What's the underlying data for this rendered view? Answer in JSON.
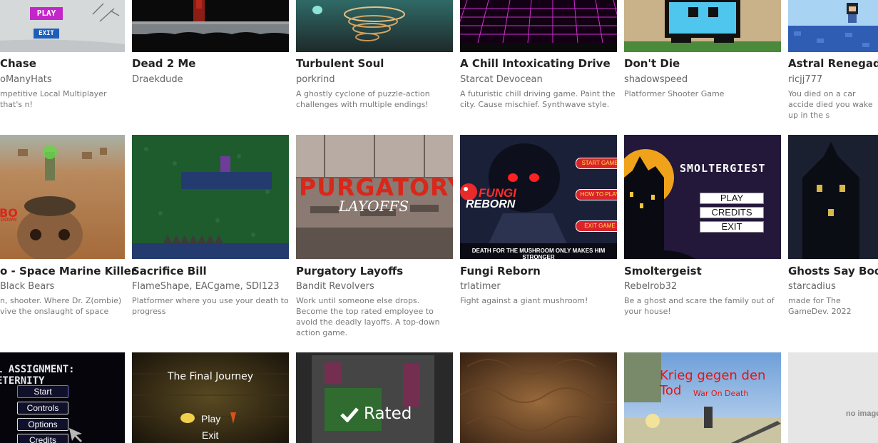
{
  "colors": {
    "title": "#222222",
    "author": "#666666",
    "desc": "#777777",
    "background": "#ffffff"
  },
  "row1": [
    {
      "title": "Chase",
      "author": "oManyHats",
      "desc": "mpetitive Local Multiplayer that's n!",
      "thumb": {
        "play": "PLAY",
        "exit": "EXIT"
      }
    },
    {
      "title": "Dead 2 Me",
      "author": "Draekdude",
      "desc": ""
    },
    {
      "title": "Turbulent Soul",
      "author": "porkrind",
      "desc": "A ghostly cyclone of puzzle-action challenges with multiple endings!"
    },
    {
      "title": "A Chill Intoxicating Drive",
      "author": "Starcat Devocean",
      "desc": "A futuristic chill driving game. Paint the city. Cause mischief. Synthwave style."
    },
    {
      "title": "Don't Die",
      "author": "shadowspeed",
      "desc": "Platformer Shooter Game"
    },
    {
      "title": "Astral Renegades",
      "author": "ricjj777",
      "desc": "You died on a car accide died you wake up in the s"
    }
  ],
  "row2": [
    {
      "title": "o - Space Marine Killer",
      "author": "Black Bears",
      "desc": "n, shooter. Where Dr. Z(ombie) vive the onslaught of space",
      "thumb": {
        "logo": "BO",
        "sub": "DOWN"
      }
    },
    {
      "title": "Sacrifice Bill",
      "author": "FlameShape, EACgame, SDI123",
      "desc": "Platformer where you use your death to progress"
    },
    {
      "title": "Purgatory Layoffs",
      "author": "Bandit Revolvers",
      "desc": "Work until someone else drops. Become the top rated employee to avoid the deadly layoffs. A top-down action game.",
      "thumb": {
        "logo": "PURGATORY",
        "sub": "LAYOFFS"
      }
    },
    {
      "title": "Fungi Reborn",
      "author": "trlatimer",
      "desc": "Fight against a giant mushroom!",
      "thumb": {
        "logo1": "FUNGI",
        "logo2": "REBORN",
        "buttons": [
          "START GAME",
          "HOW TO PLAY",
          "EXIT GAME"
        ],
        "caption": "DEATH FOR THE MUSHROOM ONLY MAKES HIM STRONGER"
      }
    },
    {
      "title": "Smoltergeist",
      "author": "Rebelrob32",
      "desc": "Be a ghost and scare the family out of your house!",
      "thumb": {
        "logo": "SMOLTERGIEST",
        "buttons": [
          "PLAY",
          "CREDITS",
          "EXIT"
        ]
      }
    },
    {
      "title": "Ghosts Say Boo!",
      "author": "starcadius",
      "desc": "made for The GameDev. 2022"
    }
  ],
  "row3": [
    {
      "thumb": {
        "logo": "L ASSIGNMENT: ETERNITY",
        "buttons": [
          "Start",
          "Controls",
          "Options",
          "Credits"
        ]
      }
    },
    {
      "thumb": {
        "logo": "The Final Journey",
        "play": "Play",
        "exit": "Exit"
      }
    },
    {
      "thumb": {
        "badge": "Rated"
      }
    },
    {
      "thumb": {}
    },
    {
      "thumb": {
        "logo": "Krieg gegen den Tod",
        "sub": "War On Death"
      }
    },
    {
      "thumb": {
        "placeholder": "no image"
      }
    }
  ]
}
